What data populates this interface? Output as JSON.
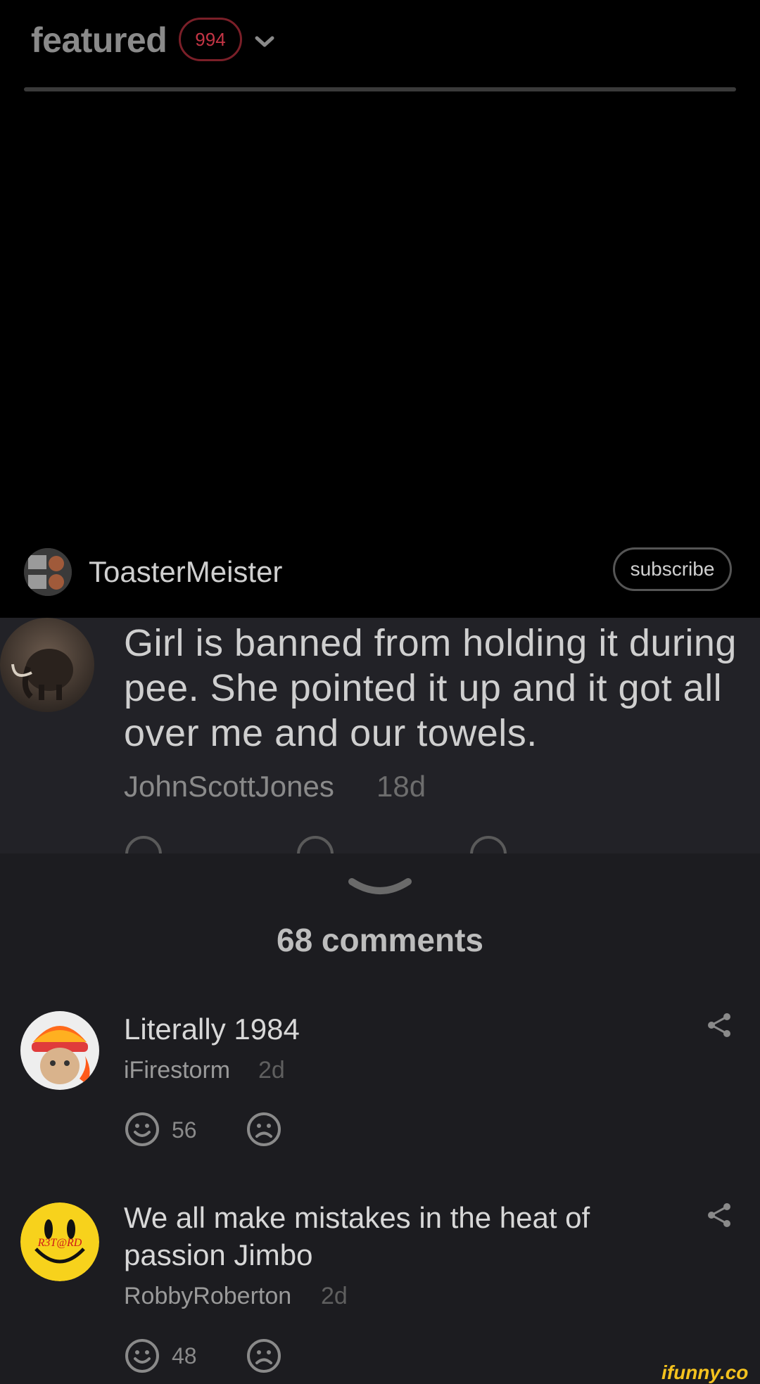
{
  "header": {
    "title": "featured",
    "badge_count": "994"
  },
  "post": {
    "author": "ToasterMeister",
    "subscribe_label": "subscribe"
  },
  "overlay_comment": {
    "text_lines": [
      "Girl is banned from holding it during",
      "pee. She pointed it up and it got all",
      "over me and our towels."
    ],
    "user": "JohnScottJones",
    "time": "18d"
  },
  "comments": {
    "count_label": "68 comments",
    "items": [
      {
        "text_lines": [
          "Literally 1984"
        ],
        "user": "iFirestorm",
        "time": "2d",
        "likes": "56"
      },
      {
        "text_lines": [
          "We all make mistakes in the heat of",
          "passion Jimbo"
        ],
        "user": "RobbyRoberton",
        "time": "2d",
        "likes": "48",
        "avatar_text": "R3T@RD"
      }
    ]
  },
  "brand": "ifunny.co",
  "colors": {
    "badge": "#c43545",
    "sheet_bg": "#1c1c20",
    "overlay_bg": "#222227",
    "brand": "#f4c21e"
  },
  "icons": {
    "chevron": "chevron-down-icon",
    "like": "smile-icon",
    "dislike": "frown-icon",
    "share": "share-icon",
    "handle": "chevron-down-icon"
  }
}
